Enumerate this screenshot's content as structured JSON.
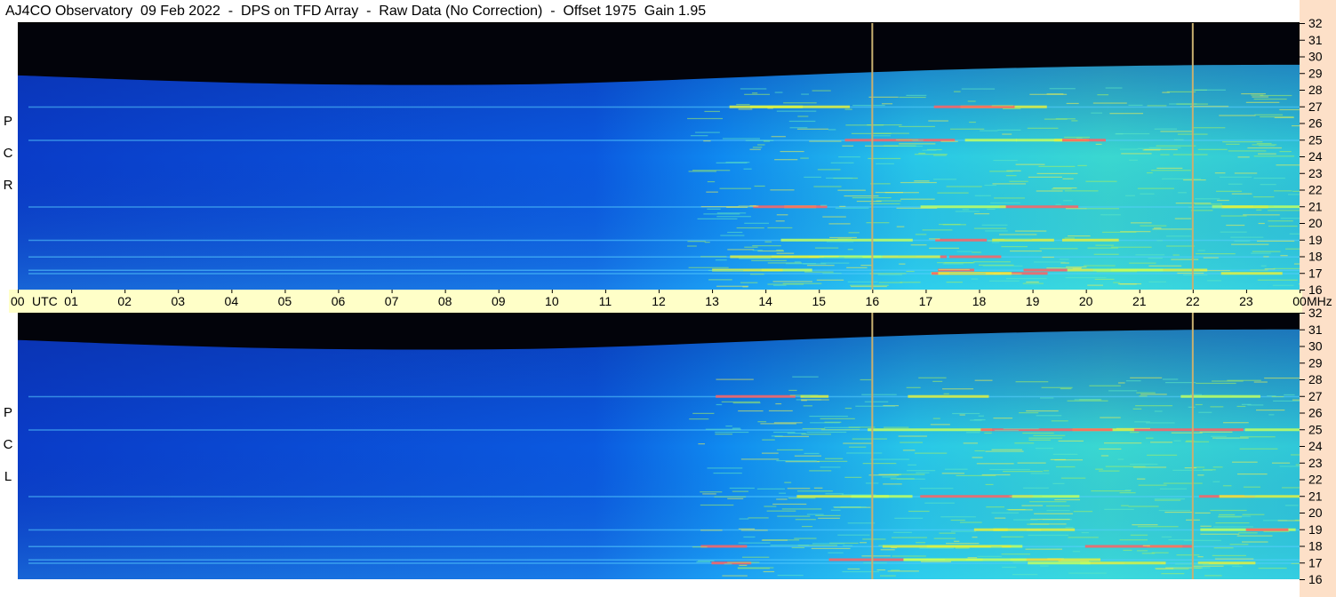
{
  "header": {
    "title": "AJ4CO Observatory  09 Feb 2022  -  DPS on TFD Array  -  Raw Data (No Correction)  -  Offset 1975  Gain 1.95"
  },
  "panels": [
    {
      "id": "rcp",
      "label_letters": [
        "R",
        "C",
        "P"
      ]
    },
    {
      "id": "lcp",
      "label_letters": [
        "L",
        "C",
        "P"
      ]
    }
  ],
  "colors": {
    "strip_bg": "#fde0c8",
    "timebar_bg": "#ffffc8",
    "marker_line": "#c8b070",
    "background_sky": "#0a3fd0"
  },
  "chart_data": {
    "type": "heatmap",
    "x_axis": {
      "unit": "UTC",
      "range_hours": [
        0,
        24
      ],
      "tick_labels": [
        "00",
        "01",
        "02",
        "03",
        "04",
        "05",
        "06",
        "07",
        "08",
        "09",
        "10",
        "11",
        "12",
        "13",
        "14",
        "15",
        "16",
        "17",
        "18",
        "19",
        "20",
        "21",
        "22",
        "23",
        "00"
      ],
      "unit_label": "UTC",
      "end_unit_label": "MHz"
    },
    "y_axis": {
      "unit": "MHz",
      "range": [
        16,
        32
      ],
      "tick_labels": [
        "32",
        "31",
        "30",
        "29",
        "28",
        "27",
        "26",
        "25",
        "24",
        "23",
        "22",
        "21",
        "20",
        "19",
        "18",
        "17",
        "16"
      ]
    },
    "marker_lines_utc": [
      16,
      22
    ],
    "series": [
      {
        "name": "RCP",
        "quiet_band_top_mhz": 29.5,
        "strong_signal_start_utc": 12.5,
        "bright_lines_mhz": [
          27,
          25,
          21,
          19,
          18,
          17.2,
          17
        ]
      },
      {
        "name": "LCP",
        "quiet_band_top_mhz": 31,
        "strong_signal_start_utc": 12.5,
        "bright_lines_mhz": [
          27,
          25,
          21,
          19,
          18,
          17.2,
          17
        ]
      }
    ]
  }
}
